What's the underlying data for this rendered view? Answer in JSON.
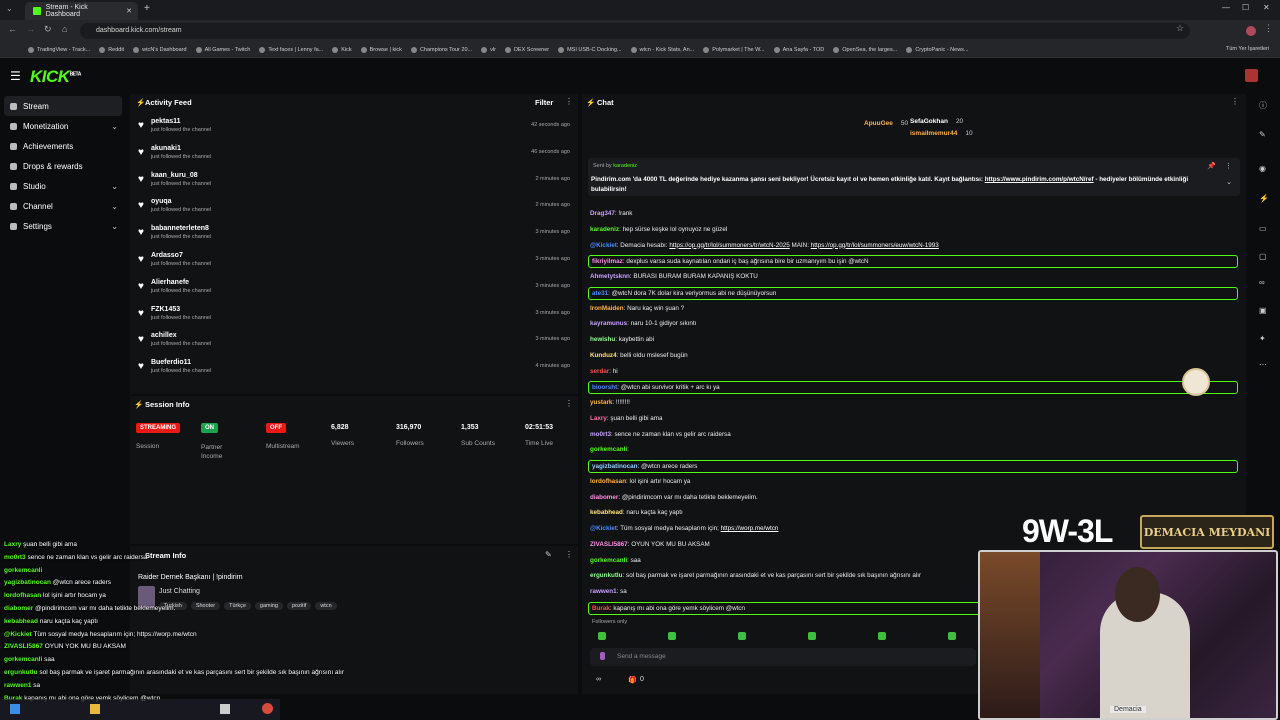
{
  "browser": {
    "tab_title": "Stream - Kick Dashboard",
    "url": "dashboard.kick.com/stream",
    "bookmarks": [
      "TradingView - Track...",
      "Reddit",
      "wtcN's Dashboard",
      "All Games - Twitch",
      "Text faces | Lenny fa...",
      "Kick",
      "Browse | kick",
      "Champions Tour 20...",
      "vlr",
      "DEX Screener",
      "MSI USB-C Docking...",
      "wtcn - Kick Stats, An...",
      "Polymarket | The W...",
      "Ana Sayfa - TOD",
      "OpenSea, the larges...",
      "CryptoPanic - News..."
    ],
    "bookmarks_all": "Tüm Yer İşaretleri"
  },
  "app": {
    "logo": "KICK",
    "logo_sup": "BETA"
  },
  "sidebar": {
    "items": [
      {
        "label": "Stream",
        "icon": "stream-icon",
        "active": true
      },
      {
        "label": "Monetization",
        "icon": "dollar-icon",
        "chevron": true
      },
      {
        "label": "Achievements",
        "icon": "trophy-icon"
      },
      {
        "label": "Drops & rewards",
        "icon": "gift-icon"
      },
      {
        "label": "Studio",
        "icon": "studio-icon",
        "chevron": true
      },
      {
        "label": "Channel",
        "icon": "channel-icon",
        "chevron": true
      },
      {
        "label": "Settings",
        "icon": "gear-icon",
        "chevron": true
      }
    ]
  },
  "activity_feed": {
    "title": "Activity Feed",
    "filter_label": "Filter",
    "sub": "just followed the channel",
    "items": [
      {
        "name": "pektas11",
        "time": "42 seconds ago"
      },
      {
        "name": "akunaki1",
        "time": "46 seconds ago"
      },
      {
        "name": "kaan_kuru_08",
        "time": "2 minutes ago"
      },
      {
        "name": "oyuqa",
        "time": "2 minutes ago"
      },
      {
        "name": "babanneterleten8",
        "time": "3 minutes ago"
      },
      {
        "name": "Ardasso7",
        "time": "3 minutes ago"
      },
      {
        "name": "Alierhanefe",
        "time": "3 minutes ago"
      },
      {
        "name": "FZK1453",
        "time": "3 minutes ago"
      },
      {
        "name": "achillex",
        "time": "3 minutes ago"
      },
      {
        "name": "Bueferdio11",
        "time": "4 minutes ago"
      }
    ]
  },
  "session_info": {
    "title": "Session Info",
    "streaming_badge": "STREAMING",
    "session_label": "Session",
    "on_badge": "ON",
    "partner_label": "Partner Income",
    "off_badge": "OFF",
    "multistream_label": "Multistream",
    "viewers": "6,828",
    "viewers_label": "Viewers",
    "followers": "316,970",
    "followers_label": "Followers",
    "subs": "1,353",
    "subs_label": "Sub Counts",
    "time": "02:51:53",
    "time_label": "Time Live"
  },
  "stream_info": {
    "title": "Stream Info",
    "stream_title": "Raider Dernek Başkanı | !pindirim",
    "category": "Just Chatting",
    "tags": [
      "Turkish",
      "Shooter",
      "Türkçe",
      "gaming",
      "pozitif",
      "wtcn"
    ]
  },
  "chat": {
    "title": "Chat",
    "leaderboard": [
      {
        "name": "ApuuGee",
        "value": "50"
      },
      {
        "name": "SefaGokhan",
        "value": "20"
      },
      {
        "name": "ismailmemur44",
        "value": "10"
      }
    ],
    "pinned": {
      "sent_by_prefix": "Sent by",
      "sender": "karadeniz",
      "text": "Pindirim.com 'da 4000 TL değerinde hediye kazanma şansı seni bekliyor! Ücretsiz kayıt ol ve hemen etkinliğe katıl. Kayıt bağlantısı:",
      "link": "https://www.pindirim.com/p/wtcN/ref",
      "text2": "- hediyeler bölümünde etkinliği bulabilirsin!"
    },
    "messages": [
      {
        "user": "Drag347",
        "color": "#c9a0ff",
        "text": "!rank",
        "hl": false
      },
      {
        "user": "karadeniz",
        "color": "#53fc18",
        "text": "hep sürse keşke lol oynuyoz ne güzel",
        "hl": false
      },
      {
        "user": "@Kickiet",
        "color": "#4d8cff",
        "text": "Demacia hesabı: ",
        "link": "https://op.gg/tr/lol/summoners/tr/wtcN-2025",
        "text2": " MAIN: ",
        "link2": "https://op.gg/tr/lol/summoners/euw/wtcN-1993",
        "hl": false
      },
      {
        "user": "fikriyilmaz",
        "color": "#ff8ee8",
        "text": "dexplus varsa suda kaynatılan ondan iç baş ağrısına bire bir uzmanıyım bu işin @wtcN",
        "hl": true
      },
      {
        "user": "Ahmetytsknn",
        "color": "#c9a0ff",
        "text": "BURASI BURAM BURAM KAPANIŞ KOKTU",
        "hl": false
      },
      {
        "user": "ate31",
        "color": "#4d8cff",
        "text": "@wtcN dora 7K dolar kira veriyormus abi ne düşünüyorsun",
        "hl": true
      },
      {
        "user": "IronMaiden",
        "color": "#ffb347",
        "text": "Naru kaç win şuan ?",
        "hl": false
      },
      {
        "user": "kayramunus",
        "color": "#c9a0ff",
        "text": "naru 10-1 gidiyor sıkıntı",
        "hl": false
      },
      {
        "user": "hewishu",
        "color": "#8fff8f",
        "text": "kaybettin abi",
        "hl": false
      },
      {
        "user": "Kunduz4",
        "color": "#ffe27a",
        "text": "belli oldu mslesef bugün",
        "hl": false
      },
      {
        "user": "serdar",
        "color": "#ff4d4d",
        "text": "hi",
        "hl": false
      },
      {
        "user": "bioorsht",
        "color": "#4d8cff",
        "text": "@wtcn abi survivor kritik + arc kı ya",
        "hl": true
      },
      {
        "user": "yustark",
        "color": "#ffb347",
        "text": "!!!!!!!!",
        "hl": false
      },
      {
        "user": "Laxry",
        "color": "#ff6fa8",
        "text": "şuan belli gibi ama",
        "hl": false
      },
      {
        "user": "mo0rt3",
        "color": "#c9a0ff",
        "text": "sence ne zaman klan vs gelir arc raidersa",
        "hl": false
      },
      {
        "user": "gorkemcanli",
        "color": "#53fc18",
        "text": "",
        "hl": false
      },
      {
        "user": "yagizbatinocan",
        "color": "#8fd0ff",
        "text": "@wtcn arece raders",
        "hl": true
      },
      {
        "user": "lordofhasan",
        "color": "#ffb347",
        "text": "lol işini artır hocam ya",
        "hl": false
      },
      {
        "user": "diabomer",
        "color": "#ff8ee8",
        "text": "@pindirimcom var mı daha tetikte beklemeyelim.",
        "hl": false
      },
      {
        "user": "kebabhead",
        "color": "#ffe27a",
        "text": "naru kaçta kaç yaptı",
        "hl": false
      },
      {
        "user": "@Kickiet",
        "color": "#4d8cff",
        "text": "Tüm sosyal medya hesaplarım için; ",
        "link": "https://worp.me/wtcn",
        "hl": false
      },
      {
        "user": "ZIVASLI5867",
        "color": "#ff8ee8",
        "text": "OYUN YOK MU BU AKSAM",
        "hl": false
      },
      {
        "user": "gorkemcanli",
        "color": "#53fc18",
        "text": "saa",
        "hl": false
      },
      {
        "user": "ergunkutlu",
        "color": "#8fff8f",
        "text": "sol baş parmak ve işaret parmağının arasındaki et ve kas parçasını sert bir şekilde sık başının ağrısını alır",
        "hl": false
      },
      {
        "user": "rawwen1",
        "color": "#c9a0ff",
        "text": "sa",
        "hl": false
      },
      {
        "user": "Burak",
        "color": "#ff4d4d",
        "text": "kapanış mı abi ona göre yemk söylicem @wtcn",
        "hl": true
      }
    ],
    "followers_only": "Followers only",
    "placeholder": "Send a message",
    "count_left": "∞",
    "count_right": "0"
  },
  "overlay": {
    "score": "9W-3L",
    "banner": "DEMACIA MEYDANI",
    "webcam_label": "Demacia",
    "chat_lines": [
      {
        "user": "Laxry",
        "text": "şuan belli gibi ama"
      },
      {
        "user": "mo0rt3",
        "text": "sence ne zaman klan vs gelir arc raidersa"
      },
      {
        "user": "gorkemcanli",
        "text": ""
      },
      {
        "user": "yagizbatinocan",
        "text": "@wtcn arece raders"
      },
      {
        "user": "lordofhasan",
        "text": "lol işini artır hocam ya"
      },
      {
        "user": "diabomer",
        "text": "@pindirimcom var mı daha tetikte beklemeyelim."
      },
      {
        "user": "kebabhead",
        "text": "naru kaçta kaç yaptı"
      },
      {
        "user": "@Kickiet",
        "text": "Tüm sosyal medya hesaplarım için; https://worp.me/wtcn"
      },
      {
        "user": "ZIVASLI5867",
        "text": "OYUN YOK MU BU AKSAM"
      },
      {
        "user": "gorkemcanli",
        "text": "saa"
      },
      {
        "user": "ergunkutlu",
        "text": "sol baş parmak ve işaret parmağının arasındaki et ve kas parçasını sert bir şekilde sık başının ağrısını alır"
      },
      {
        "user": "rawwen1",
        "text": "sa"
      },
      {
        "user": "Burak",
        "text": "kapanış mı abi ona göre yemk söylicem @wtcn"
      }
    ]
  },
  "colors": {
    "brand": "#53fc18",
    "streaming": "#e91916",
    "on": "#1aa34a"
  }
}
